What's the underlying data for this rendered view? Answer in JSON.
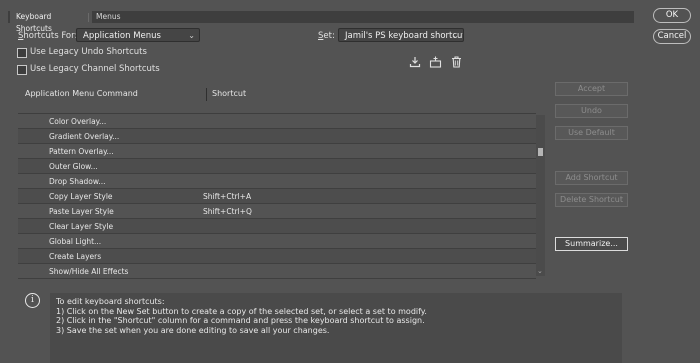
{
  "tabs": [
    {
      "label": "Keyboard Shortcuts",
      "active": true
    },
    {
      "label": "Menus",
      "active": false
    }
  ],
  "dialog_buttons": {
    "ok": "OK",
    "cancel": "Cancel"
  },
  "shortcuts_for": {
    "label_prefix": "S",
    "label_rest": "hortcuts For:",
    "value": "Application Menus"
  },
  "set": {
    "label_prefix": "S",
    "label_rest": "et:",
    "value": "Jamil's PS keyboard shortcuts..."
  },
  "checkboxes": [
    {
      "label": "Use Legacy Undo Shortcuts",
      "checked": false
    },
    {
      "label": "Use Legacy Channel Shortcuts",
      "checked": false
    }
  ],
  "set_icons": [
    "save-set-icon",
    "new-set-icon",
    "delete-set-icon"
  ],
  "table": {
    "columns": [
      "Application Menu Command",
      "Shortcut"
    ],
    "rows": [
      {
        "command": "Color Overlay...",
        "shortcut": ""
      },
      {
        "command": "Gradient Overlay...",
        "shortcut": ""
      },
      {
        "command": "Pattern Overlay...",
        "shortcut": ""
      },
      {
        "command": "Outer Glow...",
        "shortcut": ""
      },
      {
        "command": "Drop Shadow...",
        "shortcut": ""
      },
      {
        "command": "Copy Layer Style",
        "shortcut": "Shift+Ctrl+A"
      },
      {
        "command": "Paste Layer Style",
        "shortcut": "Shift+Ctrl+Q"
      },
      {
        "command": "Clear Layer Style",
        "shortcut": ""
      },
      {
        "command": "Global Light...",
        "shortcut": ""
      },
      {
        "command": "Create Layers",
        "shortcut": ""
      },
      {
        "command": "Show/Hide All Effects",
        "shortcut": ""
      }
    ]
  },
  "side_buttons": {
    "accept": "Accept",
    "undo": "Undo",
    "use_default": "Use Default",
    "add_shortcut": "Add Shortcut",
    "delete_shortcut": "Delete Shortcut",
    "summarize": "Summarize..."
  },
  "info": {
    "icon": "info-icon",
    "lines": [
      "To edit keyboard shortcuts:",
      "1) Click on the New Set button to create a copy of the selected set, or select a set to modify.",
      "2) Click in the \"Shortcut\" column for a command and press the keyboard shortcut to assign.",
      "3) Save the set when you are done editing to save all your changes."
    ]
  }
}
